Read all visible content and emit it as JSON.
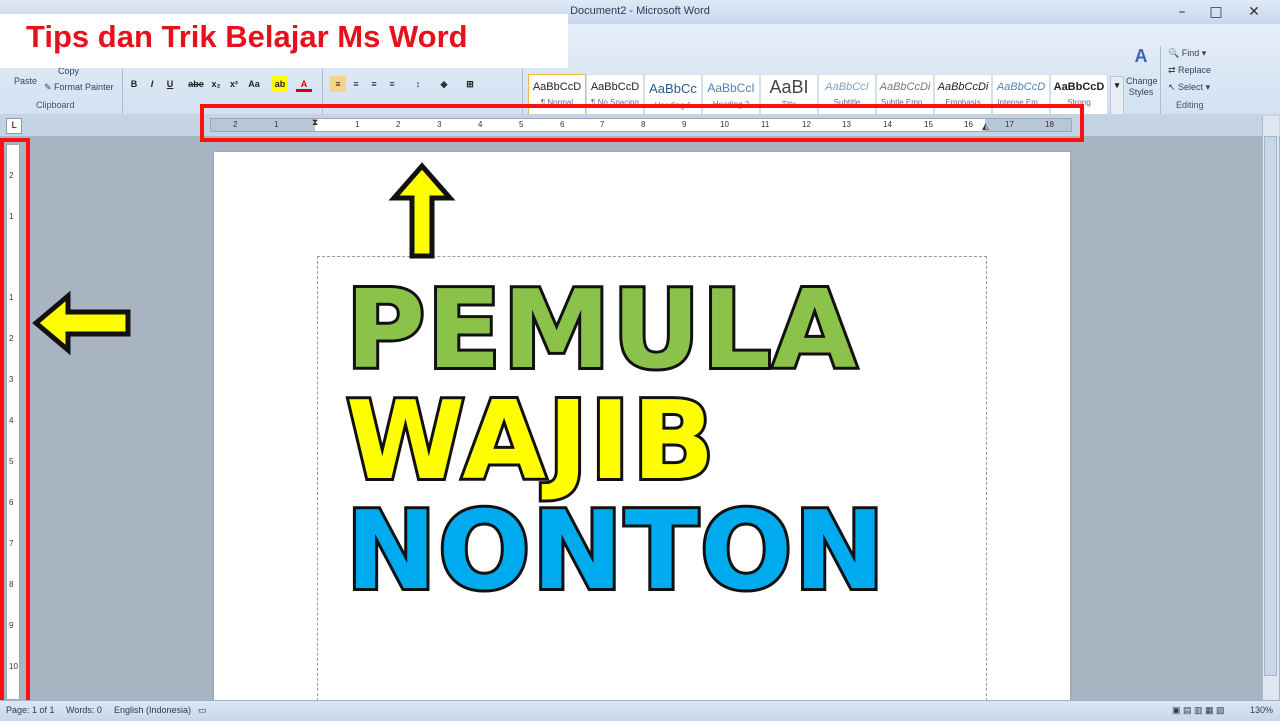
{
  "window": {
    "title": "Document2 - Microsoft Word"
  },
  "banner": {
    "text": "Tips dan Trik Belajar Ms Word",
    "color": "#e8101a"
  },
  "clipboard": {
    "paste": "Paste",
    "copy": "Copy",
    "format_painter": "Format Painter",
    "group": "Clipboard"
  },
  "font_buttons": [
    "B",
    "I",
    "U",
    "abe",
    "x₂",
    "x²",
    "Aa"
  ],
  "styles": [
    {
      "preview": "AaBbCcD",
      "name": "¶ Normal"
    },
    {
      "preview": "AaBbCcD",
      "name": "¶ No Spacing"
    },
    {
      "preview": "AaBbCc",
      "name": "Heading 1"
    },
    {
      "preview": "AaBbCcI",
      "name": "Heading 2"
    },
    {
      "preview": "AaBI",
      "name": "Title"
    },
    {
      "preview": "AaBbCcI",
      "name": "Subtitle"
    },
    {
      "preview": "AaBbCcDi",
      "name": "Subtle Emp..."
    },
    {
      "preview": "AaBbCcDi",
      "name": "Emphasis"
    },
    {
      "preview": "AaBbCcD",
      "name": "Intense Em..."
    },
    {
      "preview": "AaBbCcD",
      "name": "Strong"
    }
  ],
  "change_styles": "Change Styles",
  "editing": {
    "find": "Find",
    "replace": "Replace",
    "select": "Select",
    "group": "Editing"
  },
  "ruler": {
    "numbers": [
      "2",
      "1",
      "1",
      "2",
      "3",
      "4",
      "5",
      "6",
      "7",
      "8",
      "9",
      "10",
      "11",
      "12",
      "13",
      "14",
      "15",
      "16",
      "17",
      "18"
    ]
  },
  "vruler": {
    "numbers": [
      "2",
      "1",
      "1",
      "2",
      "3",
      "4",
      "5",
      "6",
      "7",
      "8",
      "9",
      "10"
    ]
  },
  "document": {
    "words": [
      {
        "text": "PEMULA",
        "color": "#8bc34a"
      },
      {
        "text": "WAJIB",
        "color": "#ffff00"
      },
      {
        "text": "NONTON",
        "color": "#00aaee"
      }
    ]
  },
  "status": {
    "page": "Page: 1 of 1",
    "words": "Words: 0",
    "language": "English (Indonesia)",
    "zoom": "130%"
  },
  "icons": [
    "up-arrow-icon",
    "left-arrow-icon"
  ]
}
